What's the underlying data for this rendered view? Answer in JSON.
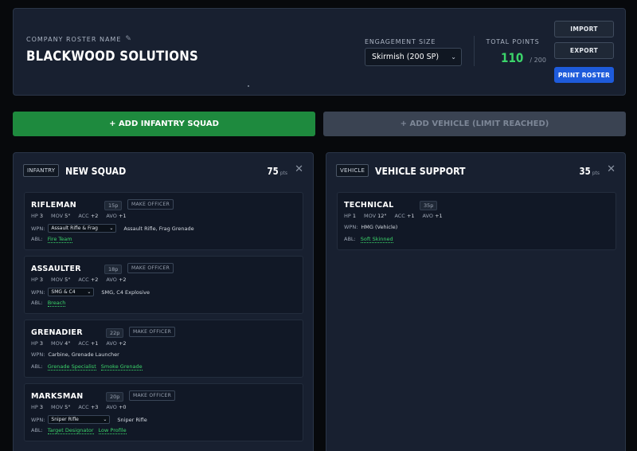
{
  "header": {
    "roster_label": "COMPANY ROSTER NAME",
    "roster_name": "BLACKWOOD SOLUTIONS",
    "engagement_label": "ENGAGEMENT SIZE",
    "engagement_value": "Skirmish (200 SP)",
    "total_points_label": "TOTAL POINTS",
    "total_points": "110",
    "total_points_max": "/ 200",
    "import_label": "IMPORT",
    "export_label": "EXPORT",
    "print_label": "PRINT ROSTER"
  },
  "actions": {
    "add_infantry": "+ ADD INFANTRY SQUAD",
    "add_vehicle": "+ ADD VEHICLE (LIMIT REACHED)"
  },
  "colors": {
    "accent_green": "#3bd46a",
    "primary_blue": "#1e5bdb",
    "add_green": "#1e8a3e"
  },
  "squads": [
    {
      "tag": "INFANTRY",
      "title": "NEW SQUAD",
      "points": "75",
      "points_unit": "pts",
      "units": [
        {
          "name": "RIFLEMAN",
          "cost": "15p",
          "officer": "MAKE OFFICER",
          "hp": "3",
          "mov": "5\"",
          "acc": "+2",
          "avo": "+1",
          "weapon_select": "Assault Rifle & Frag",
          "weapons": "Assault Rifle,  Frag Grenade",
          "abilities": [
            "Fire Team"
          ]
        },
        {
          "name": "ASSAULTER",
          "cost": "18p",
          "officer": "MAKE OFFICER",
          "hp": "3",
          "mov": "5\"",
          "acc": "+2",
          "avo": "+2",
          "weapon_select": "SMG & C4",
          "weapons": "SMG,  C4 Explosive",
          "abilities": [
            "Breach"
          ]
        },
        {
          "name": "GRENADIER",
          "cost": "22p",
          "officer": "MAKE OFFICER",
          "hp": "3",
          "mov": "4\"",
          "acc": "+1",
          "avo": "+2",
          "weapons": "Carbine,  Grenade Launcher",
          "abilities": [
            "Grenade Specialist",
            "Smoke Grenade"
          ]
        },
        {
          "name": "MARKSMAN",
          "cost": "20p",
          "officer": "MAKE OFFICER",
          "hp": "3",
          "mov": "5\"",
          "acc": "+3",
          "avo": "+0",
          "weapon_select": "Sniper Rifle",
          "weapons": "Sniper Rifle",
          "abilities": [
            "Target Designator",
            "Low Profile"
          ]
        }
      ]
    },
    {
      "tag": "VEHICLE",
      "title": "VEHICLE SUPPORT",
      "points": "35",
      "points_unit": "pts",
      "units": [
        {
          "name": "TECHNICAL",
          "cost": "35p",
          "hp": "1",
          "mov": "12\"",
          "acc": "+1",
          "avo": "+1",
          "weapons": "HMG (Vehicle)",
          "abilities": [
            "Soft Skinned"
          ]
        }
      ]
    }
  ],
  "labels": {
    "hp": "HP",
    "mov": "MOV",
    "acc": "ACC",
    "avo": "AVO",
    "wpn": "WPN:",
    "abl": "ABL:"
  }
}
